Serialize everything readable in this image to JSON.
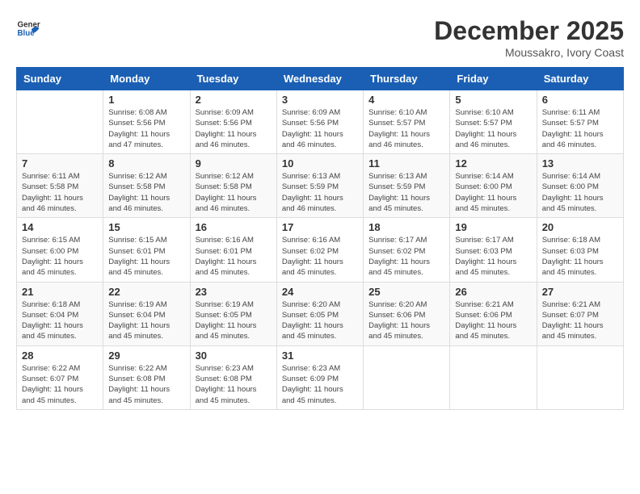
{
  "header": {
    "logo_general": "General",
    "logo_blue": "Blue",
    "month": "December 2025",
    "location": "Moussakro, Ivory Coast"
  },
  "days_of_week": [
    "Sunday",
    "Monday",
    "Tuesday",
    "Wednesday",
    "Thursday",
    "Friday",
    "Saturday"
  ],
  "weeks": [
    [
      {
        "day": "",
        "sunrise": "",
        "sunset": "",
        "daylight": ""
      },
      {
        "day": "1",
        "sunrise": "Sunrise: 6:08 AM",
        "sunset": "Sunset: 5:56 PM",
        "daylight": "Daylight: 11 hours and 47 minutes."
      },
      {
        "day": "2",
        "sunrise": "Sunrise: 6:09 AM",
        "sunset": "Sunset: 5:56 PM",
        "daylight": "Daylight: 11 hours and 46 minutes."
      },
      {
        "day": "3",
        "sunrise": "Sunrise: 6:09 AM",
        "sunset": "Sunset: 5:56 PM",
        "daylight": "Daylight: 11 hours and 46 minutes."
      },
      {
        "day": "4",
        "sunrise": "Sunrise: 6:10 AM",
        "sunset": "Sunset: 5:57 PM",
        "daylight": "Daylight: 11 hours and 46 minutes."
      },
      {
        "day": "5",
        "sunrise": "Sunrise: 6:10 AM",
        "sunset": "Sunset: 5:57 PM",
        "daylight": "Daylight: 11 hours and 46 minutes."
      },
      {
        "day": "6",
        "sunrise": "Sunrise: 6:11 AM",
        "sunset": "Sunset: 5:57 PM",
        "daylight": "Daylight: 11 hours and 46 minutes."
      }
    ],
    [
      {
        "day": "7",
        "sunrise": "Sunrise: 6:11 AM",
        "sunset": "Sunset: 5:58 PM",
        "daylight": "Daylight: 11 hours and 46 minutes."
      },
      {
        "day": "8",
        "sunrise": "Sunrise: 6:12 AM",
        "sunset": "Sunset: 5:58 PM",
        "daylight": "Daylight: 11 hours and 46 minutes."
      },
      {
        "day": "9",
        "sunrise": "Sunrise: 6:12 AM",
        "sunset": "Sunset: 5:58 PM",
        "daylight": "Daylight: 11 hours and 46 minutes."
      },
      {
        "day": "10",
        "sunrise": "Sunrise: 6:13 AM",
        "sunset": "Sunset: 5:59 PM",
        "daylight": "Daylight: 11 hours and 46 minutes."
      },
      {
        "day": "11",
        "sunrise": "Sunrise: 6:13 AM",
        "sunset": "Sunset: 5:59 PM",
        "daylight": "Daylight: 11 hours and 45 minutes."
      },
      {
        "day": "12",
        "sunrise": "Sunrise: 6:14 AM",
        "sunset": "Sunset: 6:00 PM",
        "daylight": "Daylight: 11 hours and 45 minutes."
      },
      {
        "day": "13",
        "sunrise": "Sunrise: 6:14 AM",
        "sunset": "Sunset: 6:00 PM",
        "daylight": "Daylight: 11 hours and 45 minutes."
      }
    ],
    [
      {
        "day": "14",
        "sunrise": "Sunrise: 6:15 AM",
        "sunset": "Sunset: 6:00 PM",
        "daylight": "Daylight: 11 hours and 45 minutes."
      },
      {
        "day": "15",
        "sunrise": "Sunrise: 6:15 AM",
        "sunset": "Sunset: 6:01 PM",
        "daylight": "Daylight: 11 hours and 45 minutes."
      },
      {
        "day": "16",
        "sunrise": "Sunrise: 6:16 AM",
        "sunset": "Sunset: 6:01 PM",
        "daylight": "Daylight: 11 hours and 45 minutes."
      },
      {
        "day": "17",
        "sunrise": "Sunrise: 6:16 AM",
        "sunset": "Sunset: 6:02 PM",
        "daylight": "Daylight: 11 hours and 45 minutes."
      },
      {
        "day": "18",
        "sunrise": "Sunrise: 6:17 AM",
        "sunset": "Sunset: 6:02 PM",
        "daylight": "Daylight: 11 hours and 45 minutes."
      },
      {
        "day": "19",
        "sunrise": "Sunrise: 6:17 AM",
        "sunset": "Sunset: 6:03 PM",
        "daylight": "Daylight: 11 hours and 45 minutes."
      },
      {
        "day": "20",
        "sunrise": "Sunrise: 6:18 AM",
        "sunset": "Sunset: 6:03 PM",
        "daylight": "Daylight: 11 hours and 45 minutes."
      }
    ],
    [
      {
        "day": "21",
        "sunrise": "Sunrise: 6:18 AM",
        "sunset": "Sunset: 6:04 PM",
        "daylight": "Daylight: 11 hours and 45 minutes."
      },
      {
        "day": "22",
        "sunrise": "Sunrise: 6:19 AM",
        "sunset": "Sunset: 6:04 PM",
        "daylight": "Daylight: 11 hours and 45 minutes."
      },
      {
        "day": "23",
        "sunrise": "Sunrise: 6:19 AM",
        "sunset": "Sunset: 6:05 PM",
        "daylight": "Daylight: 11 hours and 45 minutes."
      },
      {
        "day": "24",
        "sunrise": "Sunrise: 6:20 AM",
        "sunset": "Sunset: 6:05 PM",
        "daylight": "Daylight: 11 hours and 45 minutes."
      },
      {
        "day": "25",
        "sunrise": "Sunrise: 6:20 AM",
        "sunset": "Sunset: 6:06 PM",
        "daylight": "Daylight: 11 hours and 45 minutes."
      },
      {
        "day": "26",
        "sunrise": "Sunrise: 6:21 AM",
        "sunset": "Sunset: 6:06 PM",
        "daylight": "Daylight: 11 hours and 45 minutes."
      },
      {
        "day": "27",
        "sunrise": "Sunrise: 6:21 AM",
        "sunset": "Sunset: 6:07 PM",
        "daylight": "Daylight: 11 hours and 45 minutes."
      }
    ],
    [
      {
        "day": "28",
        "sunrise": "Sunrise: 6:22 AM",
        "sunset": "Sunset: 6:07 PM",
        "daylight": "Daylight: 11 hours and 45 minutes."
      },
      {
        "day": "29",
        "sunrise": "Sunrise: 6:22 AM",
        "sunset": "Sunset: 6:08 PM",
        "daylight": "Daylight: 11 hours and 45 minutes."
      },
      {
        "day": "30",
        "sunrise": "Sunrise: 6:23 AM",
        "sunset": "Sunset: 6:08 PM",
        "daylight": "Daylight: 11 hours and 45 minutes."
      },
      {
        "day": "31",
        "sunrise": "Sunrise: 6:23 AM",
        "sunset": "Sunset: 6:09 PM",
        "daylight": "Daylight: 11 hours and 45 minutes."
      },
      {
        "day": "",
        "sunrise": "",
        "sunset": "",
        "daylight": ""
      },
      {
        "day": "",
        "sunrise": "",
        "sunset": "",
        "daylight": ""
      },
      {
        "day": "",
        "sunrise": "",
        "sunset": "",
        "daylight": ""
      }
    ]
  ]
}
